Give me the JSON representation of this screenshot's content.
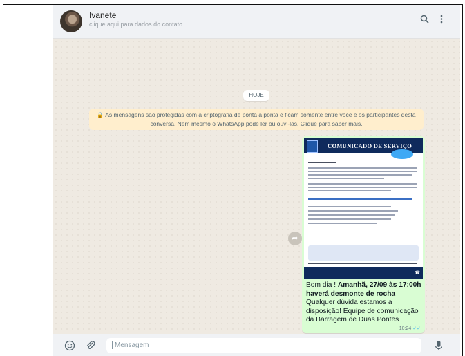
{
  "contact": {
    "name": "Ivanete",
    "subtitle": "clique aqui para dados do contato"
  },
  "header_icons": [
    "search-icon",
    "menu-icon"
  ],
  "date_label": "HOJE",
  "encryption_notice": "As mensagens são protegidas com a criptografia de ponta a ponta e ficam somente entre você e os participantes desta conversa. Nem mesmo o WhatsApp pode ler ou ouvi-las. Clique para saber mais.",
  "image": {
    "title": "COMUNICADO DE SERVIÇO"
  },
  "message": {
    "part1": "Bom dia ! ",
    "bold1": "Amanhã, 27/09 às 17:00h haverá desmonte de rocha",
    "part2": " Qualquer dúvida estamos a disposição! Equipe de comunicação da Barragem de Duas Pontes",
    "time": "10:24"
  },
  "composer": {
    "placeholder": "Mensagem"
  },
  "colors": {
    "chat_bg": "#efeae2",
    "outgoing_bubble": "#d9fdd3",
    "notice_bg": "#ffeecd",
    "header_bg": "#f0f2f5"
  }
}
